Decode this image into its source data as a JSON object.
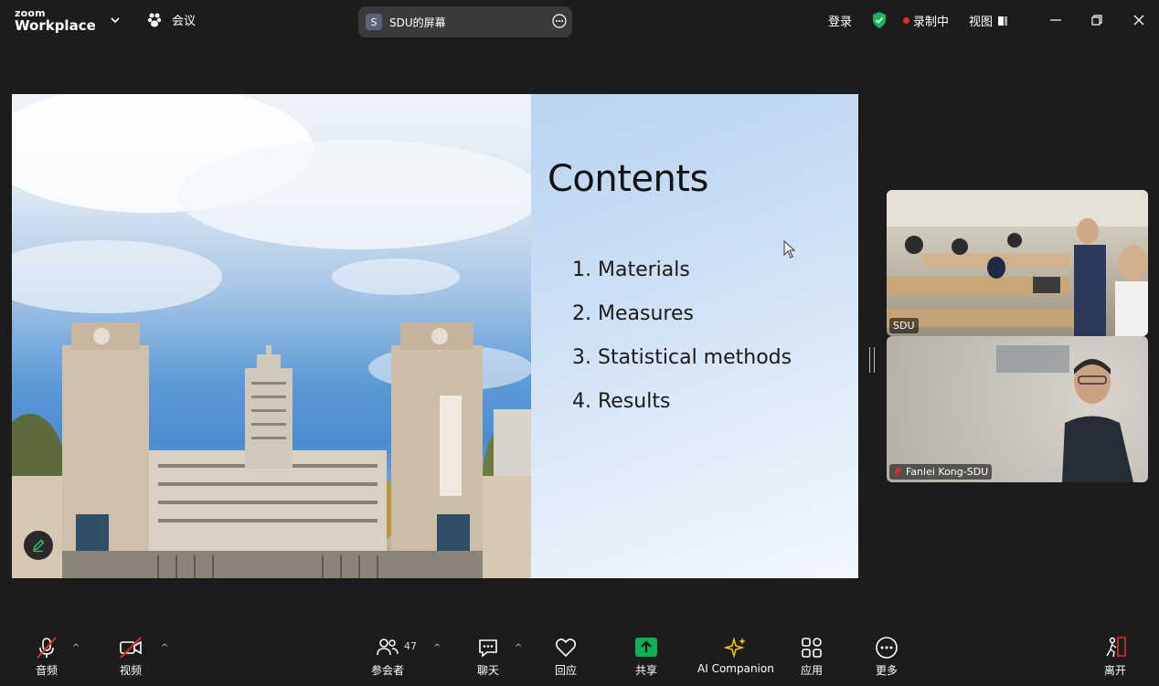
{
  "app": {
    "brand_top": "zoom",
    "brand_bottom": "Workplace"
  },
  "header": {
    "meeting_label": "会议",
    "share": {
      "badge": "S",
      "title": "SDU的屏幕"
    },
    "login": "登录",
    "recording": "录制中",
    "view": "视图"
  },
  "slide": {
    "title": "Contents",
    "items": [
      "1. Materials",
      "2. Measures",
      "3. Statistical methods",
      "4. Results"
    ]
  },
  "participants": [
    {
      "name": "SDU"
    },
    {
      "name": "Fanlei Kong-SDU"
    }
  ],
  "toolbar": {
    "audio": "音频",
    "video": "视频",
    "participants": "参会者",
    "participants_count": "47",
    "chat": "聊天",
    "react": "回应",
    "share": "共享",
    "ai": "AI Companion",
    "apps": "应用",
    "more": "更多",
    "leave": "离开"
  },
  "colors": {
    "accent_green": "#0bb157",
    "danger_red": "#e02b2b",
    "shield_green": "#19b35c"
  }
}
